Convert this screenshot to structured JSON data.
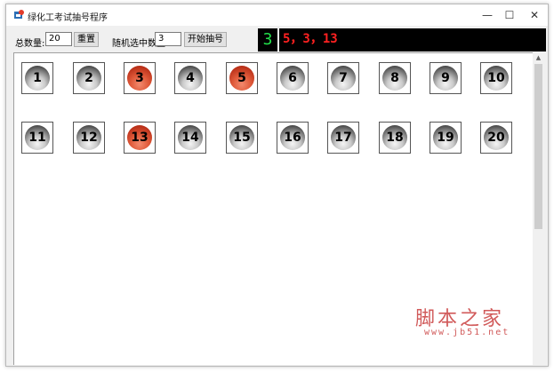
{
  "window": {
    "title": "绿化工考试抽号程序",
    "controls": {
      "minimize": "—",
      "maximize": "☐",
      "close": "✕"
    }
  },
  "toolbar": {
    "total_label": "总数量:",
    "total_value": "20",
    "reset_label": "重置",
    "random_label": "随机选中数量:",
    "random_value": "3",
    "start_label": "开始抽号"
  },
  "display": {
    "current": "3",
    "result": "5，3，13"
  },
  "balls": [
    {
      "n": "1",
      "selected": false
    },
    {
      "n": "2",
      "selected": false
    },
    {
      "n": "3",
      "selected": true
    },
    {
      "n": "4",
      "selected": false
    },
    {
      "n": "5",
      "selected": true
    },
    {
      "n": "6",
      "selected": false
    },
    {
      "n": "7",
      "selected": false
    },
    {
      "n": "8",
      "selected": false
    },
    {
      "n": "9",
      "selected": false
    },
    {
      "n": "10",
      "selected": false
    },
    {
      "n": "11",
      "selected": false
    },
    {
      "n": "12",
      "selected": false
    },
    {
      "n": "13",
      "selected": true
    },
    {
      "n": "14",
      "selected": false
    },
    {
      "n": "15",
      "selected": false
    },
    {
      "n": "16",
      "selected": false
    },
    {
      "n": "17",
      "selected": false
    },
    {
      "n": "18",
      "selected": false
    },
    {
      "n": "19",
      "selected": false
    },
    {
      "n": "20",
      "selected": false
    }
  ],
  "watermark": {
    "text": "脚本之家",
    "url": "www.jb51.net"
  },
  "colors": {
    "selected": "#d9452a",
    "led_green": "#22e04a",
    "led_red": "#ff2121"
  }
}
